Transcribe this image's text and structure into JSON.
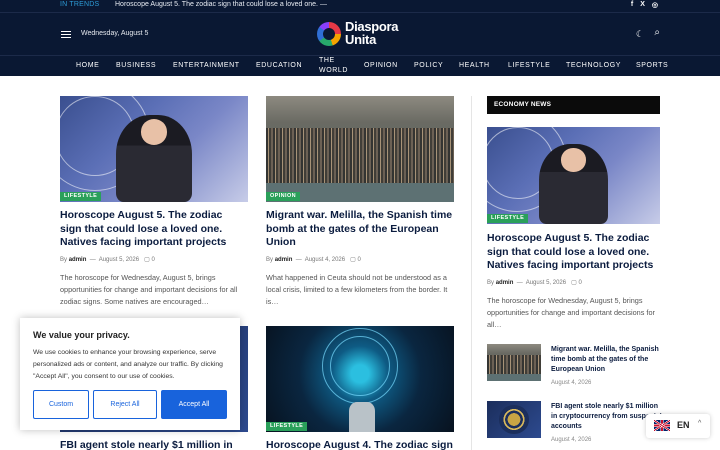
{
  "topbar": {
    "trends_label": "IN TRENDS",
    "trends_text": "Horoscope August 5. The zodiac sign that could lose a loved one. —",
    "social_icons": [
      "facebook-icon",
      "x-icon",
      "instagram-icon"
    ],
    "social_glyphs": [
      "f",
      "X",
      "◎"
    ]
  },
  "header": {
    "date": "Wednesday, August 5",
    "logo_line1": "Diaspora",
    "logo_line2": "Unita",
    "moon_glyph": "☾",
    "search_glyph": "⌕"
  },
  "nav": {
    "items": [
      "HOME",
      "BUSINESS",
      "ENTERTAINMENT",
      "EDUCATION",
      "THE",
      "WORLD",
      "OPINION",
      "POLICY",
      "HEALTH",
      "LIFESTYLE",
      "TECHNOLOGY",
      "SPORTS"
    ]
  },
  "posts": [
    {
      "category": "LIFESTYLE",
      "title": "Horoscope August 5. The zodiac sign that could lose a loved one. Natives facing important projects",
      "author": "admin",
      "date": "August 5, 2026",
      "comments": "0",
      "excerpt": "The horoscope for Wednesday, August 5, brings opportunities for change and important decisions for all zodiac signs. Some natives are encouraged…"
    },
    {
      "category": "OPINION",
      "title": "Migrant war. Melilla, the Spanish time bomb at the gates of the European Union",
      "author": "admin",
      "date": "August 4, 2026",
      "comments": "0",
      "excerpt": "What happened in Ceuta should not be understood as a local crisis, limited to a few kilometers from the border. It is…"
    },
    {
      "category": "",
      "title": "FBI agent stole nearly $1 million in"
    },
    {
      "category": "LIFESTYLE",
      "title": "Horoscope August 4. The zodiac sign"
    }
  ],
  "meta": {
    "by": "By",
    "sep": "—"
  },
  "sidebar": {
    "heading": "ECONOMY NEWS",
    "featured": {
      "category": "LIFESTYLE",
      "title": "Horoscope August 5. The zodiac sign that could lose a loved one. Natives facing important projects",
      "author": "admin",
      "date": "August 5, 2026",
      "comments": "0",
      "excerpt": "The horoscope for Wednesday, August 5, brings opportunities for change and important decisions for all…"
    },
    "mini": [
      {
        "title": "Migrant war. Melilla, the Spanish time bomb at the gates of the European Union",
        "date": "August 4, 2026"
      },
      {
        "title": "FBI agent stole nearly $1 million in cryptocurrency from suspects' accounts",
        "date": "August 4, 2026"
      }
    ]
  },
  "cookie": {
    "title": "We value your privacy.",
    "text": "We use cookies to enhance your browsing experience, serve personalized ads or content, and analyze our traffic. By clicking \"Accept All\", you consent to our use of cookies.",
    "customize": "Custom",
    "reject": "Reject All",
    "accept": "Accept All"
  },
  "language": {
    "code": "EN",
    "arrow": "^"
  },
  "colors": {
    "header_bg": "#0a1833",
    "category_green": "#2aa05a",
    "accent_blue": "#1863dc"
  }
}
